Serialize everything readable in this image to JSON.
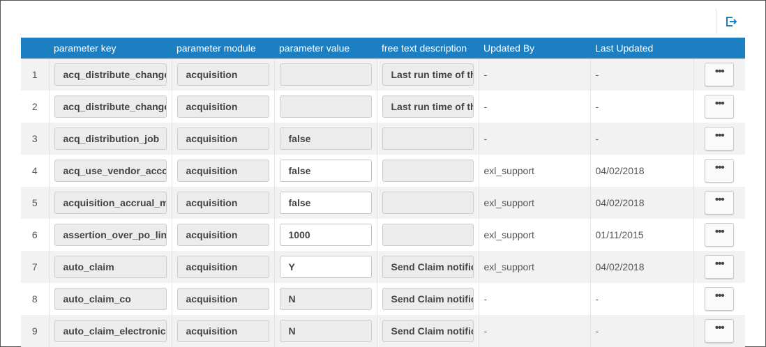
{
  "toolbar": {
    "export_icon": "export-icon"
  },
  "headers": [
    "",
    "parameter key",
    "parameter module",
    "parameter value",
    "free text description",
    "Updated By",
    "Last Updated",
    ""
  ],
  "rows": [
    {
      "num": "1",
      "key": "acq_distribute_change",
      "module": "acquisition",
      "value": "",
      "value_editable": false,
      "desc": "Last run time of the",
      "by": "-",
      "date": "-"
    },
    {
      "num": "2",
      "key": "acq_distribute_change",
      "module": "acquisition",
      "value": "",
      "value_editable": false,
      "desc": "Last run time of the",
      "by": "-",
      "date": "-"
    },
    {
      "num": "3",
      "key": "acq_distribution_job",
      "module": "acquisition",
      "value": "false",
      "value_editable": false,
      "desc": "",
      "by": "-",
      "date": "-"
    },
    {
      "num": "4",
      "key": "acq_use_vendor_account",
      "module": "acquisition",
      "value": "false",
      "value_editable": true,
      "desc": "",
      "by": "exl_support",
      "date": "04/02/2018"
    },
    {
      "num": "5",
      "key": "acquisition_accrual_mode",
      "module": "acquisition",
      "value": "false",
      "value_editable": true,
      "desc": "",
      "by": "exl_support",
      "date": "04/02/2018"
    },
    {
      "num": "6",
      "key": "assertion_over_po_line",
      "module": "acquisition",
      "value": "1000",
      "value_editable": true,
      "desc": "",
      "by": "exl_support",
      "date": "01/11/2015"
    },
    {
      "num": "7",
      "key": "auto_claim",
      "module": "acquisition",
      "value": "Y",
      "value_editable": true,
      "desc": "Send Claim notification",
      "by": "exl_support",
      "date": "04/02/2018"
    },
    {
      "num": "8",
      "key": "auto_claim_co",
      "module": "acquisition",
      "value": "N",
      "value_editable": false,
      "desc": "Send Claim notification",
      "by": "-",
      "date": "-"
    },
    {
      "num": "9",
      "key": "auto_claim_electronic",
      "module": "acquisition",
      "value": "N",
      "value_editable": false,
      "desc": "Send Claim notification",
      "by": "-",
      "date": "-"
    }
  ],
  "more_label": "•••",
  "colors": {
    "header_bg": "#1c7fc2",
    "row_alt": "#f2f2f2"
  }
}
